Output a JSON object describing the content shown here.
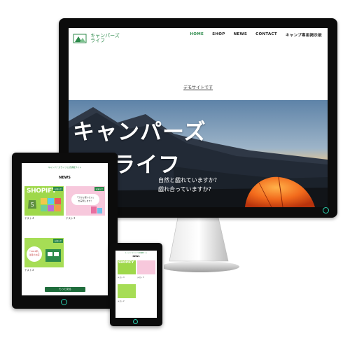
{
  "monitor": {
    "logo": {
      "text_line1": "キャンパーズ",
      "text_line2": "ライフ"
    },
    "nav": [
      {
        "label": "HOME",
        "active": true
      },
      {
        "label": "SHOP",
        "active": false
      },
      {
        "label": "NEWS",
        "active": false
      },
      {
        "label": "CONTACT",
        "active": false
      },
      {
        "label": "キャンプ専用掲示板",
        "active": false
      }
    ],
    "demo_notice": "デモサイトです",
    "hero": {
      "title_line1": "キャンパーズ",
      "title_line2": "ライフ",
      "subtitle_line1": "自然と戯れていますか？",
      "subtitle_line2": "戯れ合っていますか？"
    }
  },
  "tablet": {
    "header": "キャンパーズライフ公式通販サイト",
    "section_title": "NEWS",
    "cards": [
      {
        "thumb_text": "SHOPIFY",
        "badge": "お知らせ",
        "title": "テスト４",
        "meta": ""
      },
      {
        "thumb_text": "「うちも使いたい」\nを実現します！",
        "badge": "お知らせ",
        "title": "テスト３",
        "meta": ""
      },
      {
        "thumb_text": "「2023年」\n注目のお店",
        "badge": "お知らせ",
        "title": "テスト２",
        "meta": ""
      }
    ],
    "more_button": "もっと見る"
  },
  "phone": {
    "header": "キャンパーズライフ公式通販サイト",
    "section_title": "NEWS",
    "cards": [
      {
        "thumb_text": "SHOPIFY",
        "title": "テスト４"
      },
      {
        "thumb_text": "",
        "title": "テスト３"
      },
      {
        "thumb_text": "",
        "title": "テスト２"
      }
    ]
  },
  "colors": {
    "brand_green": "#2c8a4a",
    "button_green": "#1f6d3c",
    "power_led": "#2bd1b0",
    "device_bezel": "#0c0c0c"
  }
}
